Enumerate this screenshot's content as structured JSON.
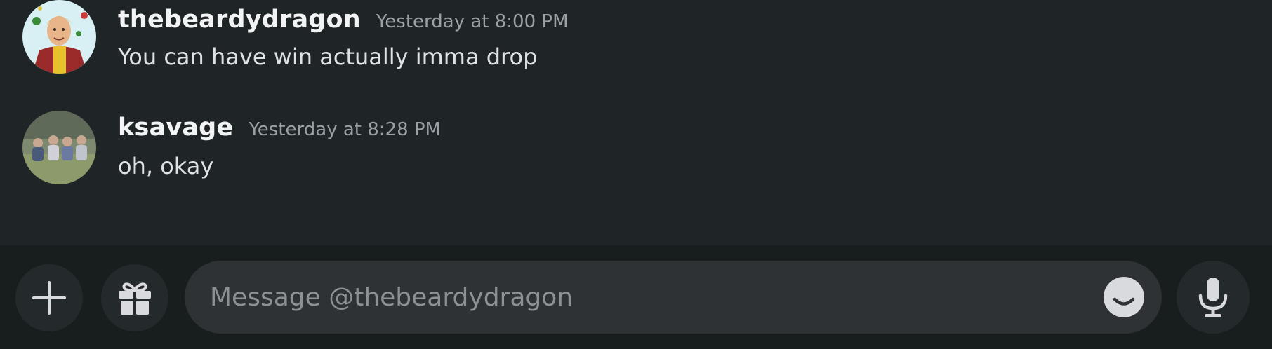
{
  "messages": [
    {
      "username": "thebeardydragon",
      "timestamp": "Yesterday at 8:00 PM",
      "text": "You can have win actually imma drop",
      "avatar": "avatar-thebeardydragon"
    },
    {
      "username": "ksavage",
      "timestamp": "Yesterday at 8:28 PM",
      "text": "oh, okay",
      "avatar": "avatar-ksavage"
    }
  ],
  "composer": {
    "placeholder": "Message @thebeardydragon",
    "value": "",
    "icons": [
      "plus-icon",
      "gift-icon",
      "emoji-icon",
      "microphone-icon"
    ]
  },
  "colors": {
    "background": "#1f2526",
    "composer_bar": "#181d1e",
    "input": "#2e3234",
    "username": "#f2f3f5",
    "timestamp": "#9aa0a6",
    "text": "#dfe1e5"
  }
}
